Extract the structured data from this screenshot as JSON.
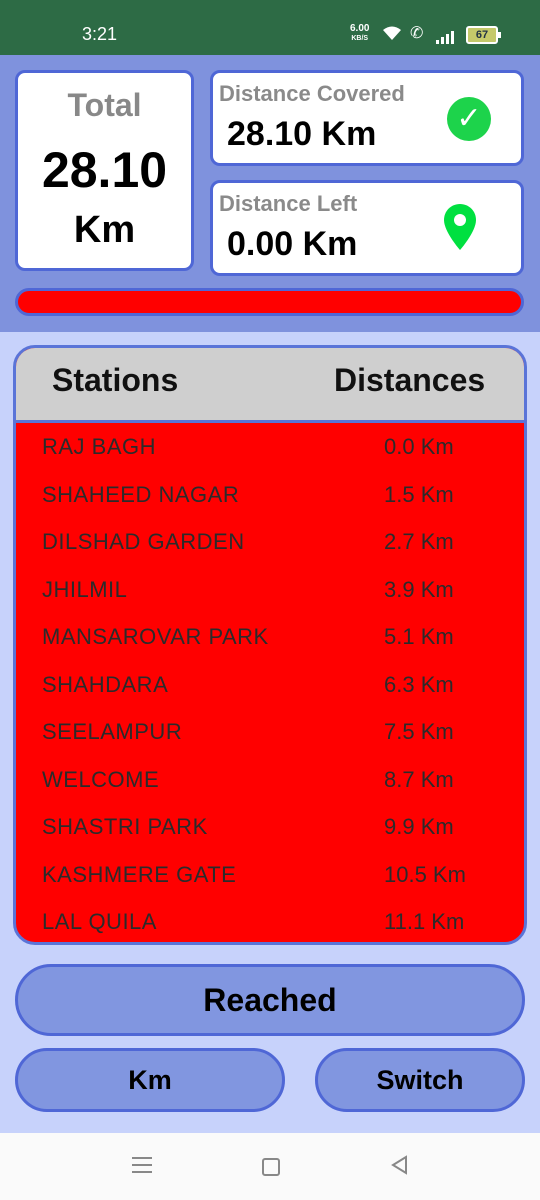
{
  "status_bar": {
    "time": "3:21",
    "net_speed": "6.00",
    "net_unit": "KB/S",
    "battery": "67",
    "icons": [
      "wifi-icon",
      "call-icon",
      "signal-icon",
      "battery-icon"
    ]
  },
  "summary": {
    "total_label": "Total",
    "total_value": "28.10",
    "total_unit": "Km",
    "covered_label": "Distance Covered",
    "covered_value": "28.10 Km",
    "left_label": "Distance Left",
    "left_value": "0.00 Km",
    "progress_fraction": 1.0
  },
  "table": {
    "headers": [
      "Stations",
      "Distances"
    ],
    "rows": [
      {
        "station": "RAJ BAGH",
        "distance": "0.0 Km"
      },
      {
        "station": "SHAHEED NAGAR",
        "distance": "1.5 Km"
      },
      {
        "station": "DILSHAD GARDEN",
        "distance": "2.7 Km"
      },
      {
        "station": "JHILMIL",
        "distance": "3.9 Km"
      },
      {
        "station": "MANSAROVAR PARK",
        "distance": "5.1 Km"
      },
      {
        "station": "SHAHDARA",
        "distance": "6.3 Km"
      },
      {
        "station": "SEELAMPUR",
        "distance": "7.5 Km"
      },
      {
        "station": "WELCOME",
        "distance": "8.7 Km"
      },
      {
        "station": "SHASTRI PARK",
        "distance": "9.9 Km"
      },
      {
        "station": "KASHMERE GATE",
        "distance": "10.5 Km"
      },
      {
        "station": "LAL QUILA",
        "distance": "11.1 Km"
      }
    ]
  },
  "buttons": {
    "reached": "Reached",
    "km": "Km",
    "switch": "Switch"
  },
  "colors": {
    "accent": "#4f67d6",
    "panel": "#7f92dd",
    "progress": "#ff0000",
    "check": "#1dd34b"
  }
}
